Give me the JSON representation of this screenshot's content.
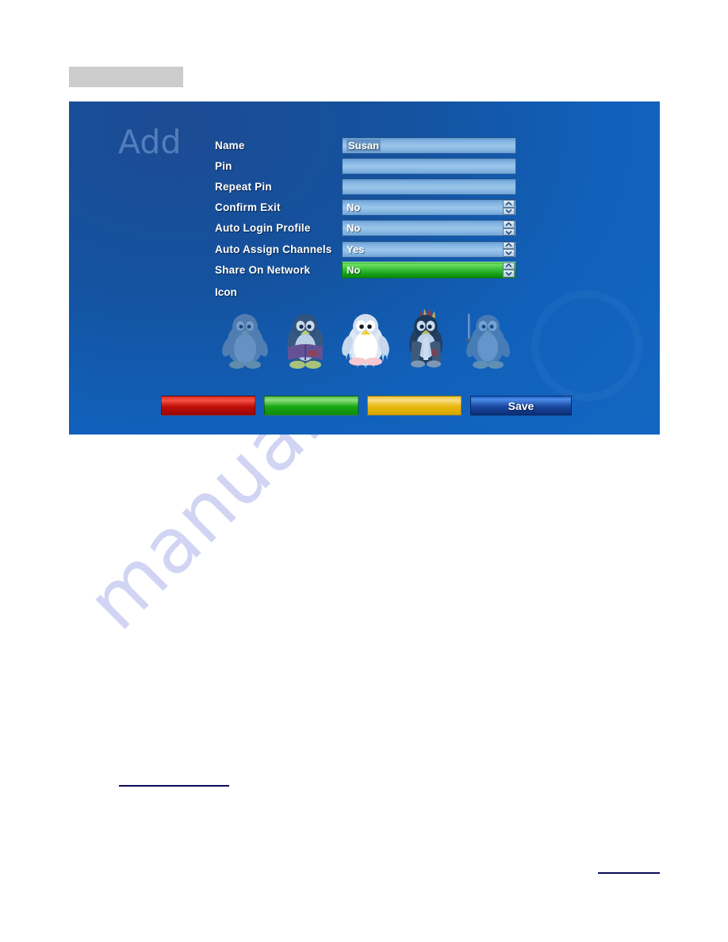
{
  "page": {
    "watermark": "manualshive.com",
    "redacted_heading": ""
  },
  "screen": {
    "title": "Add",
    "icon_section_label": "Icon",
    "fields": [
      {
        "label": "Name",
        "type": "text",
        "value": "Susan",
        "highlighted": false
      },
      {
        "label": "Pin",
        "type": "text",
        "value": "",
        "highlighted": false
      },
      {
        "label": "Repeat Pin",
        "type": "text",
        "value": "",
        "highlighted": false
      },
      {
        "label": "Confirm Exit",
        "type": "spin",
        "value": "No",
        "highlighted": false
      },
      {
        "label": "Auto Login Profile",
        "type": "spin",
        "value": "No",
        "highlighted": false
      },
      {
        "label": "Auto Assign Channels",
        "type": "spin",
        "value": "Yes",
        "highlighted": false
      },
      {
        "label": "Share On Network",
        "type": "spin",
        "value": "No",
        "highlighted": true
      }
    ],
    "spin_options": [
      "Yes",
      "No"
    ],
    "icons": [
      {
        "name": "penguin-plain",
        "selected": false
      },
      {
        "name": "penguin-reader",
        "selected": false
      },
      {
        "name": "penguin-frozen",
        "selected": false
      },
      {
        "name": "penguin-punk",
        "selected": false
      },
      {
        "name": "penguin-warrior",
        "selected": false
      }
    ],
    "buttons": [
      {
        "color_name": "red",
        "label": "",
        "color": "#d01a10"
      },
      {
        "color_name": "green",
        "label": "",
        "color": "#1aa814"
      },
      {
        "color_name": "yellow",
        "label": "",
        "color": "#e8b80e"
      },
      {
        "color_name": "blue",
        "label": "Save",
        "color": "#1b4ba5"
      }
    ]
  }
}
